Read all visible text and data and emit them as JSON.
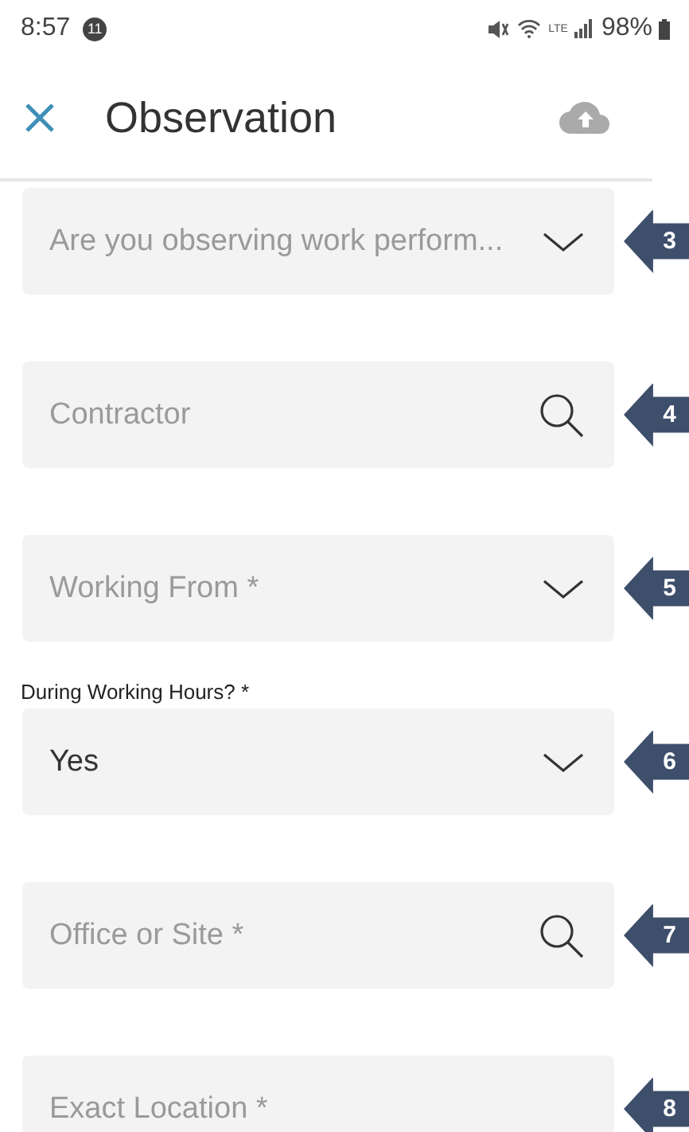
{
  "status_bar": {
    "time": "8:57",
    "notification_count": "11",
    "network": "LTE",
    "battery": "98%"
  },
  "header": {
    "title": "Observation"
  },
  "fields": [
    {
      "kind": "dropdown",
      "placeholder": "Are you observing work perform...",
      "callout": "3"
    },
    {
      "kind": "search",
      "placeholder": "Contractor",
      "callout": "4"
    },
    {
      "kind": "dropdown",
      "placeholder": "Working From *",
      "callout": "5"
    },
    {
      "kind": "dropdown",
      "label": "During Working Hours? *",
      "value": "Yes",
      "callout": "6"
    },
    {
      "kind": "search",
      "placeholder": "Office or Site *",
      "callout": "7"
    },
    {
      "kind": "text",
      "placeholder": "Exact Location *",
      "callout": "8"
    }
  ]
}
